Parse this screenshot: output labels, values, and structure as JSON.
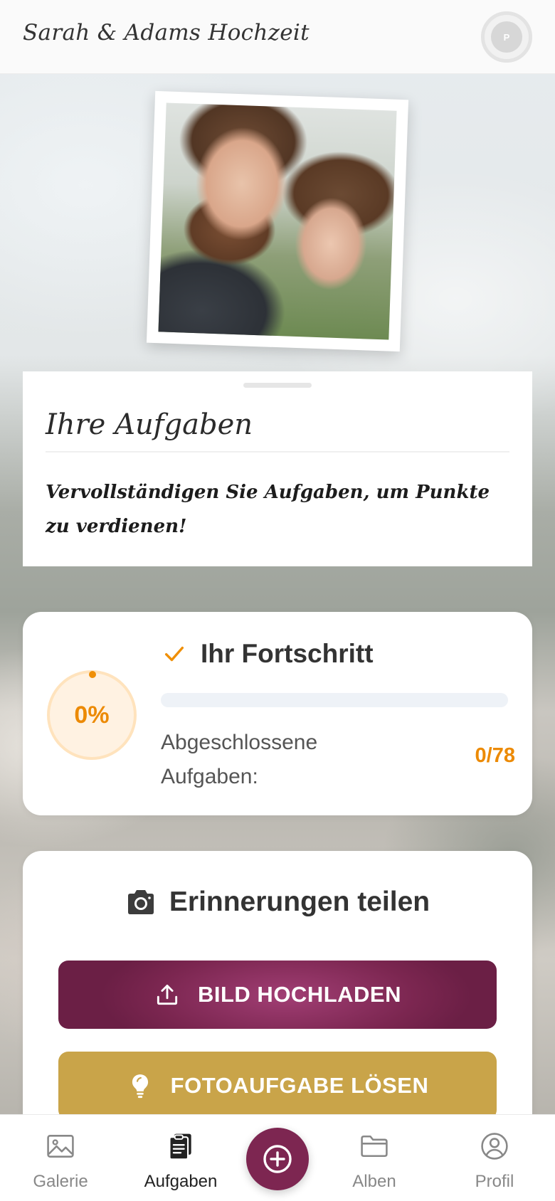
{
  "header": {
    "title": "Sarah & Adams Hochzeit",
    "avatar_initial": "P"
  },
  "hero": {
    "photo_description_icon": "couple-photo"
  },
  "tasks": {
    "title": "Ihre Aufgaben",
    "subtitle": "Vervollständigen Sie Aufgaben, um Punkte zu verdienen!"
  },
  "progress": {
    "title": "Ihr Fortschritt",
    "percent_label": "0%",
    "percent": 0,
    "completed_label": "Abgeschlossene Aufgaben:",
    "completed_count": "0/78",
    "accent_color": "#EC8A05"
  },
  "share": {
    "title": "Erinnerungen teilen",
    "upload_label": "BILD HOCHLADEN",
    "photo_task_label": "FOTOAUFGABE LÖSEN",
    "upload_color": "#7B2650",
    "photo_task_color": "#C9A449"
  },
  "nav": {
    "items": [
      {
        "label": "Galerie",
        "icon": "image-icon",
        "active": false
      },
      {
        "label": "Aufgaben",
        "icon": "clipboard-icon",
        "active": true
      },
      {
        "label": "Alben",
        "icon": "folder-icon",
        "active": false
      },
      {
        "label": "Profil",
        "icon": "user-circle-icon",
        "active": false
      }
    ],
    "fab_icon": "plus-circle-icon"
  }
}
